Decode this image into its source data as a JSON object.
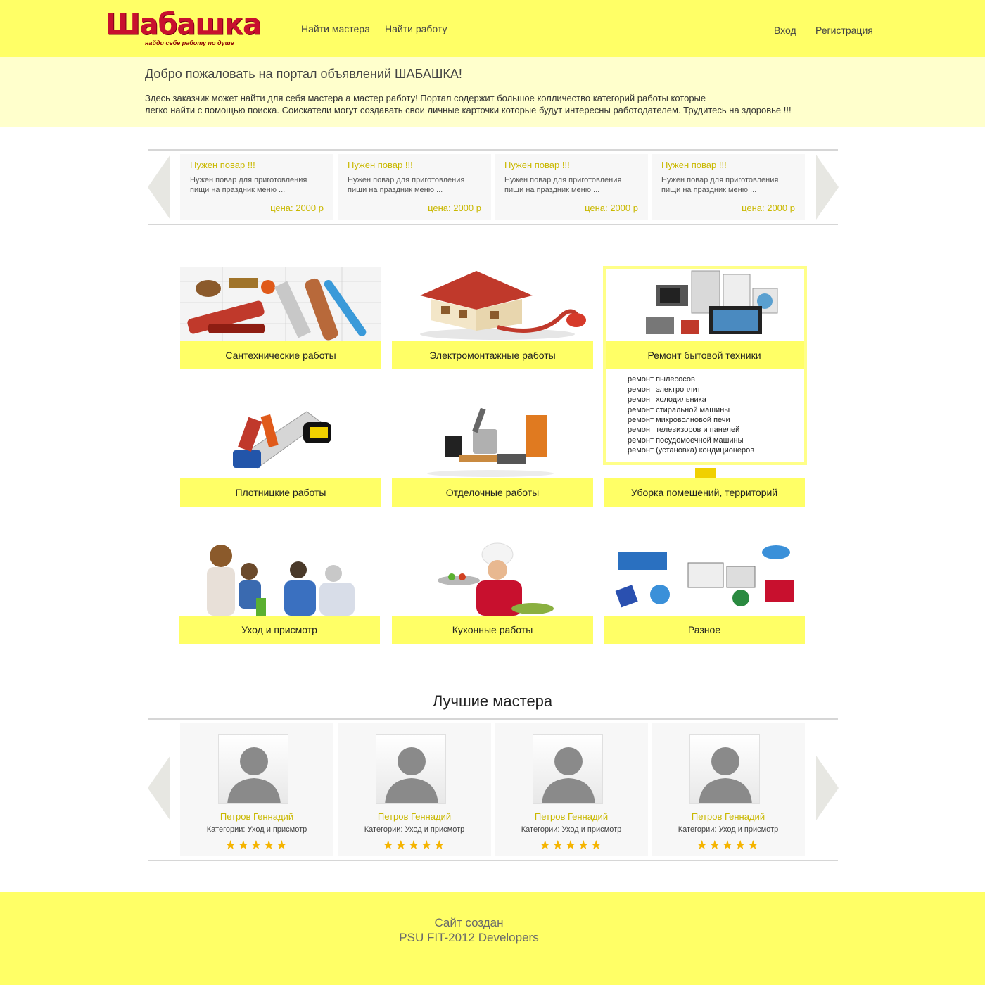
{
  "header": {
    "logo_text": "Шабашка",
    "logo_tagline": "найди себе работу по душе",
    "nav": [
      "Найти мастера",
      "Найти работу"
    ],
    "login": "Вход",
    "register": "Регистрация"
  },
  "welcome": {
    "title": "Добро пожаловать на портал объявлений ШАБАШКА!",
    "line1": "Здесь заказчик может найти для себя мастера а мастер работу! Портал содержит большое колличество категорий работы которые",
    "line2": "легко найти с помощью поиска. Соискатели могут создавать свои личные карточки которые будут интересны работодателем. Трудитесь на здоровье !!!"
  },
  "ads": [
    {
      "title": "Нужен повар !!!",
      "desc1": "Нужен повар для приготовления",
      "desc2": "пищи на праздник меню ...",
      "price": "цена: 2000 р"
    },
    {
      "title": "Нужен повар !!!",
      "desc1": "Нужен повар для приготовления",
      "desc2": "пищи на праздник меню ...",
      "price": "цена: 2000 р"
    },
    {
      "title": "Нужен повар !!!",
      "desc1": "Нужен повар для приготовления",
      "desc2": "пищи на праздник меню ...",
      "price": "цена: 2000 р"
    },
    {
      "title": "Нужен повар !!!",
      "desc1": "Нужен повар для приготовления",
      "desc2": "пищи на праздник меню ...",
      "price": "цена: 2000 р"
    }
  ],
  "categories": [
    {
      "label": "Сантехнические работы",
      "icon": "plumbing-tools-image"
    },
    {
      "label": "Электромонтажные работы",
      "icon": "house-with-plug-image"
    },
    {
      "label": "Ремонт бытовой техники",
      "icon": "home-appliances-image"
    },
    {
      "label": "Плотницкие работы",
      "icon": "carpentry-tools-image"
    },
    {
      "label": "Отделочные работы",
      "icon": "finishing-tools-image"
    },
    {
      "label": "Уборка помещений, территорий",
      "icon": "cleaning-image"
    },
    {
      "label": "Уход и присмотр",
      "icon": "family-care-image"
    },
    {
      "label": "Кухонные работы",
      "icon": "chef-image"
    },
    {
      "label": "Разное",
      "icon": "web-devices-image"
    }
  ],
  "appliance_submenu": [
    "ремонт пылесосов",
    "ремонт электроплит",
    "ремонт холодильника",
    "ремонт стиральной машины",
    "ремонт микроволновой печи",
    "ремонт телевизоров и панелей",
    "ремонт посудомоечной машины",
    "ремонт (установка) кондиционеров"
  ],
  "masters_title": "Лучшие мастера",
  "masters": [
    {
      "name": "Петров Геннадий",
      "category": "Категории: Уход и присмотр",
      "stars": "★★★★★",
      "rating": 5
    },
    {
      "name": "Петров Геннадий",
      "category": "Категории: Уход и присмотр",
      "stars": "★★★★★",
      "rating": 5
    },
    {
      "name": "Петров Геннадий",
      "category": "Категории: Уход и присмотр",
      "stars": "★★★★★",
      "rating": 5
    },
    {
      "name": "Петров Геннадий",
      "category": "Категории: Уход и присмотр",
      "stars": "★★★★★",
      "rating": 5
    }
  ],
  "footer": {
    "line1": "Сайт создан",
    "line2": "PSU FIT-2012 Developers"
  },
  "colors": {
    "brand_yellow": "#ffff66",
    "light_yellow": "#ffffcc",
    "accent_text": "#c9b800",
    "logo_red": "#c8102e",
    "star": "#f5b400"
  }
}
